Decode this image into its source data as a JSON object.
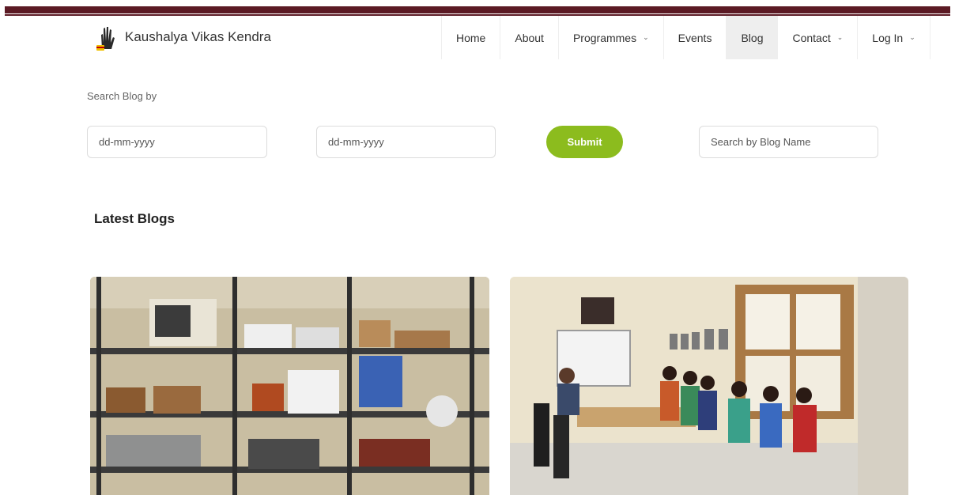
{
  "brand": {
    "name": "Kaushalya Vikas Kendra",
    "logo_icon": "hand-logo-icon"
  },
  "nav": {
    "items": [
      {
        "label": "Home"
      },
      {
        "label": "About"
      },
      {
        "label": "Programmes",
        "chevron": "⌄"
      },
      {
        "label": "Events"
      },
      {
        "label": "Blog",
        "active": true
      },
      {
        "label": "Contact",
        "chevron": "⌄"
      },
      {
        "label": "Log In",
        "chevron": "⌄"
      }
    ]
  },
  "search": {
    "title": "Search Blog by",
    "from_date_placeholder": "dd-mm-yyyy",
    "to_date_placeholder": "dd-mm-yyyy",
    "submit_label": "Submit",
    "name_placeholder": "Search by Blog Name"
  },
  "latest": {
    "heading": "Latest Blogs"
  },
  "colors": {
    "accent": "#8cbc1e",
    "topbar": "#5b1a24",
    "active_nav_bg": "#eeeeee"
  }
}
